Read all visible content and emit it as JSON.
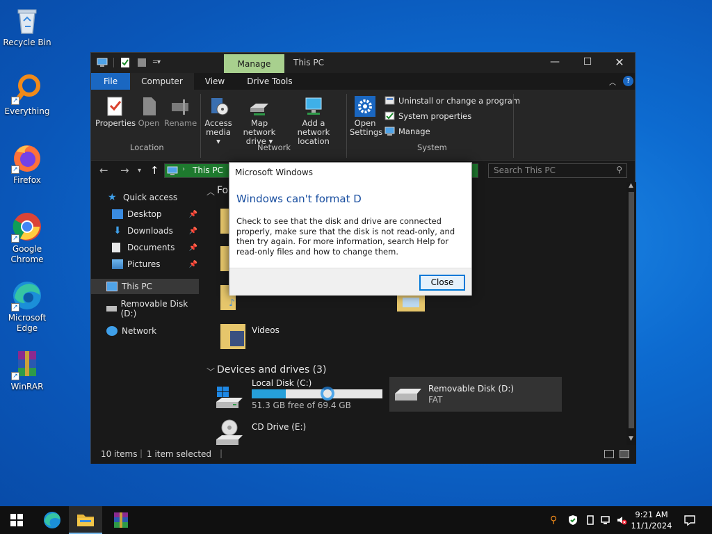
{
  "desktop": {
    "icons": [
      {
        "label": "Recycle Bin"
      },
      {
        "label": "Everything"
      },
      {
        "label": "Firefox"
      },
      {
        "label": "Google Chrome"
      },
      {
        "label": "Microsoft Edge"
      },
      {
        "label": "WinRAR"
      }
    ]
  },
  "window": {
    "title": "This PC",
    "manage_tab": "Manage",
    "tabs": [
      "File",
      "Computer",
      "View",
      "Drive Tools"
    ],
    "ribbon": {
      "location": {
        "group": "Location",
        "buttons": [
          "Properties",
          "Open",
          "Rename"
        ]
      },
      "network": {
        "group": "Network",
        "buttons": [
          "Access media ▾",
          "Map network drive ▾",
          "Add a network location"
        ]
      },
      "system": {
        "group": "System",
        "open_settings": "Open Settings",
        "items": [
          "Uninstall or change a program",
          "System properties",
          "Manage"
        ]
      }
    },
    "address": "This PC",
    "search_placeholder": "Search This PC",
    "nav": {
      "quick_access": "Quick access",
      "items": [
        "Desktop",
        "Downloads",
        "Documents",
        "Pictures"
      ],
      "this_pc": "This PC",
      "removable": "Removable Disk (D:)",
      "network": "Network"
    },
    "content": {
      "folders_header": "Fo",
      "videos": "Videos",
      "devices_header": "Devices and drives (3)",
      "drives": [
        {
          "name": "Local Disk (C:)",
          "sub": "51.3 GB free of 69.4 GB",
          "used_fraction": 0.26
        },
        {
          "name": "Removable Disk (D:)",
          "sub": "FAT"
        },
        {
          "name": "CD Drive (E:)",
          "sub": ""
        }
      ]
    },
    "status": {
      "items": "10 items",
      "selected": "1 item selected"
    }
  },
  "dialog": {
    "title": "Microsoft Windows",
    "heading": "Windows can't format D",
    "body": "Check to see that the disk and drive are connected properly, make sure that the disk is not read-only, and then try again. For more information, search Help for read-only files and how to change them.",
    "button": "Close"
  },
  "taskbar": {
    "time": "9:21 AM",
    "date": "11/1/2024"
  },
  "colors": {
    "file_tab": "#1a67c1",
    "manage_tab": "#a8d08e",
    "address_bar": "#1e7a2e",
    "dialog_heading": "#1a4fa0"
  }
}
